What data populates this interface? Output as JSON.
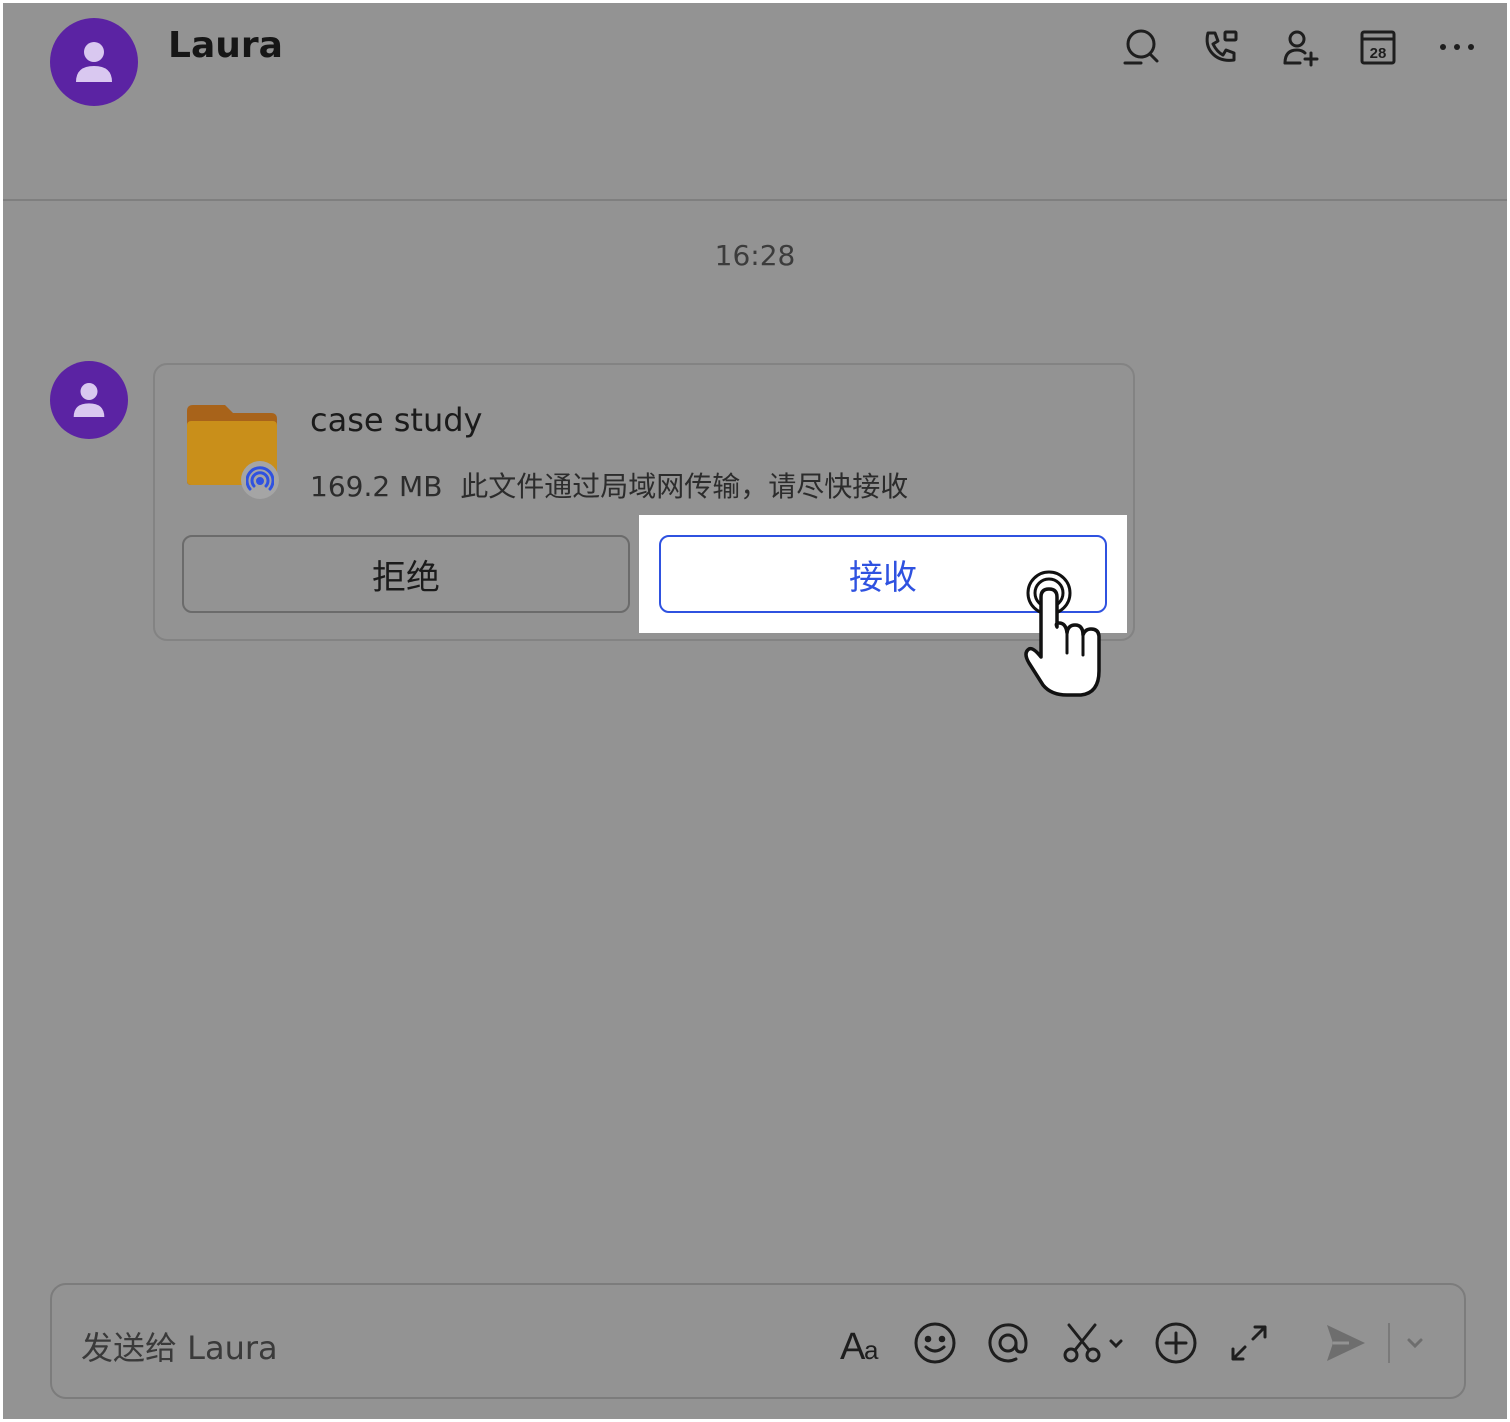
{
  "header": {
    "title": "Laura",
    "icons": [
      "chat-search-icon",
      "phone-icon",
      "add-member-icon",
      "calendar-icon",
      "more-icon"
    ],
    "calendar_day": "28"
  },
  "chat": {
    "timestamp": "16:28",
    "file_message": {
      "name": "case study",
      "size": "169.2 MB",
      "note": "此文件通过局域网传输，请尽快接收",
      "reject_label": "拒绝",
      "accept_label": "接收"
    }
  },
  "composer": {
    "placeholder": "发送给 Laura",
    "toolbar_icons": [
      "text-format-icon",
      "emoji-icon",
      "mention-icon",
      "screenshot-icon",
      "add-icon",
      "expand-icon",
      "send-icon",
      "send-options-icon"
    ]
  },
  "colors": {
    "avatar": "#5b23a3",
    "accent": "#2f52e0",
    "overlay": "#939393",
    "folder": "#c98f1a"
  }
}
